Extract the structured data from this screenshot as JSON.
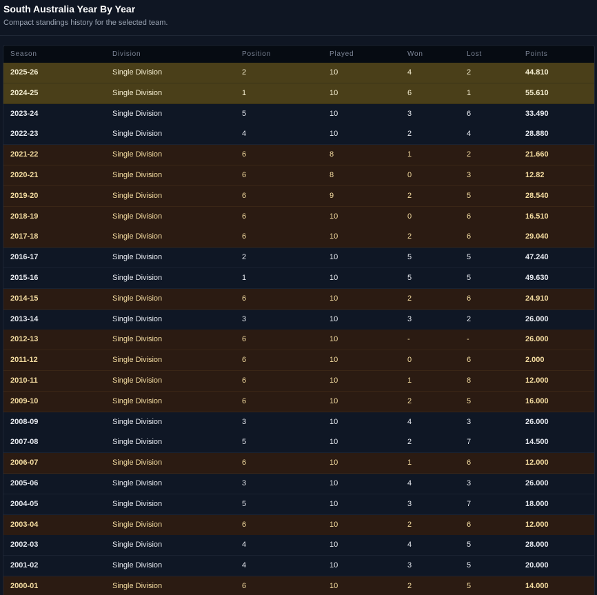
{
  "header": {
    "title": "South Australia Year By Year",
    "subtitle": "Compact standings history for the selected team."
  },
  "table": {
    "columns": [
      "Season",
      "Division",
      "Position",
      "Played",
      "Won",
      "Lost",
      "Points"
    ],
    "row_colors": {
      "gold": "#4a3f19",
      "brown": "#2b1b12",
      "plain": "#0f1725"
    },
    "rows": [
      {
        "style": "gold",
        "season": "2025-26",
        "division": "Single Division",
        "position": "2",
        "played": "10",
        "won": "4",
        "lost": "2",
        "points": "44.810"
      },
      {
        "style": "gold",
        "season": "2024-25",
        "division": "Single Division",
        "position": "1",
        "played": "10",
        "won": "6",
        "lost": "1",
        "points": "55.610"
      },
      {
        "style": "plain",
        "season": "2023-24",
        "division": "Single Division",
        "position": "5",
        "played": "10",
        "won": "3",
        "lost": "6",
        "points": "33.490"
      },
      {
        "style": "plain",
        "season": "2022-23",
        "division": "Single Division",
        "position": "4",
        "played": "10",
        "won": "2",
        "lost": "4",
        "points": "28.880"
      },
      {
        "style": "brown",
        "season": "2021-22",
        "division": "Single Division",
        "position": "6",
        "played": "8",
        "won": "1",
        "lost": "2",
        "points": "21.660"
      },
      {
        "style": "brown",
        "season": "2020-21",
        "division": "Single Division",
        "position": "6",
        "played": "8",
        "won": "0",
        "lost": "3",
        "points": "12.82"
      },
      {
        "style": "brown",
        "season": "2019-20",
        "division": "Single Division",
        "position": "6",
        "played": "9",
        "won": "2",
        "lost": "5",
        "points": "28.540"
      },
      {
        "style": "brown",
        "season": "2018-19",
        "division": "Single Division",
        "position": "6",
        "played": "10",
        "won": "0",
        "lost": "6",
        "points": "16.510"
      },
      {
        "style": "brown",
        "season": "2017-18",
        "division": "Single Division",
        "position": "6",
        "played": "10",
        "won": "2",
        "lost": "6",
        "points": "29.040"
      },
      {
        "style": "plain",
        "season": "2016-17",
        "division": "Single Division",
        "position": "2",
        "played": "10",
        "won": "5",
        "lost": "5",
        "points": "47.240"
      },
      {
        "style": "plain",
        "season": "2015-16",
        "division": "Single Division",
        "position": "1",
        "played": "10",
        "won": "5",
        "lost": "5",
        "points": "49.630"
      },
      {
        "style": "brown",
        "season": "2014-15",
        "division": "Single Division",
        "position": "6",
        "played": "10",
        "won": "2",
        "lost": "6",
        "points": "24.910"
      },
      {
        "style": "plain",
        "season": "2013-14",
        "division": "Single Division",
        "position": "3",
        "played": "10",
        "won": "3",
        "lost": "2",
        "points": "26.000"
      },
      {
        "style": "brown",
        "season": "2012-13",
        "division": "Single Division",
        "position": "6",
        "played": "10",
        "won": "-",
        "lost": "-",
        "points": "26.000"
      },
      {
        "style": "brown",
        "season": "2011-12",
        "division": "Single Division",
        "position": "6",
        "played": "10",
        "won": "0",
        "lost": "6",
        "points": "2.000"
      },
      {
        "style": "brown",
        "season": "2010-11",
        "division": "Single Division",
        "position": "6",
        "played": "10",
        "won": "1",
        "lost": "8",
        "points": "12.000"
      },
      {
        "style": "brown",
        "season": "2009-10",
        "division": "Single Division",
        "position": "6",
        "played": "10",
        "won": "2",
        "lost": "5",
        "points": "16.000"
      },
      {
        "style": "plain",
        "season": "2008-09",
        "division": "Single Division",
        "position": "3",
        "played": "10",
        "won": "4",
        "lost": "3",
        "points": "26.000"
      },
      {
        "style": "plain",
        "season": "2007-08",
        "division": "Single Division",
        "position": "5",
        "played": "10",
        "won": "2",
        "lost": "7",
        "points": "14.500"
      },
      {
        "style": "brown",
        "season": "2006-07",
        "division": "Single Division",
        "position": "6",
        "played": "10",
        "won": "1",
        "lost": "6",
        "points": "12.000"
      },
      {
        "style": "plain",
        "season": "2005-06",
        "division": "Single Division",
        "position": "3",
        "played": "10",
        "won": "4",
        "lost": "3",
        "points": "26.000"
      },
      {
        "style": "plain",
        "season": "2004-05",
        "division": "Single Division",
        "position": "5",
        "played": "10",
        "won": "3",
        "lost": "7",
        "points": "18.000"
      },
      {
        "style": "brown",
        "season": "2003-04",
        "division": "Single Division",
        "position": "6",
        "played": "10",
        "won": "2",
        "lost": "6",
        "points": "12.000"
      },
      {
        "style": "plain",
        "season": "2002-03",
        "division": "Single Division",
        "position": "4",
        "played": "10",
        "won": "4",
        "lost": "5",
        "points": "28.000"
      },
      {
        "style": "plain",
        "season": "2001-02",
        "division": "Single Division",
        "position": "4",
        "played": "10",
        "won": "3",
        "lost": "5",
        "points": "20.000"
      },
      {
        "style": "brown",
        "season": "2000-01",
        "division": "Single Division",
        "position": "6",
        "played": "10",
        "won": "2",
        "lost": "5",
        "points": "14.000"
      }
    ]
  }
}
